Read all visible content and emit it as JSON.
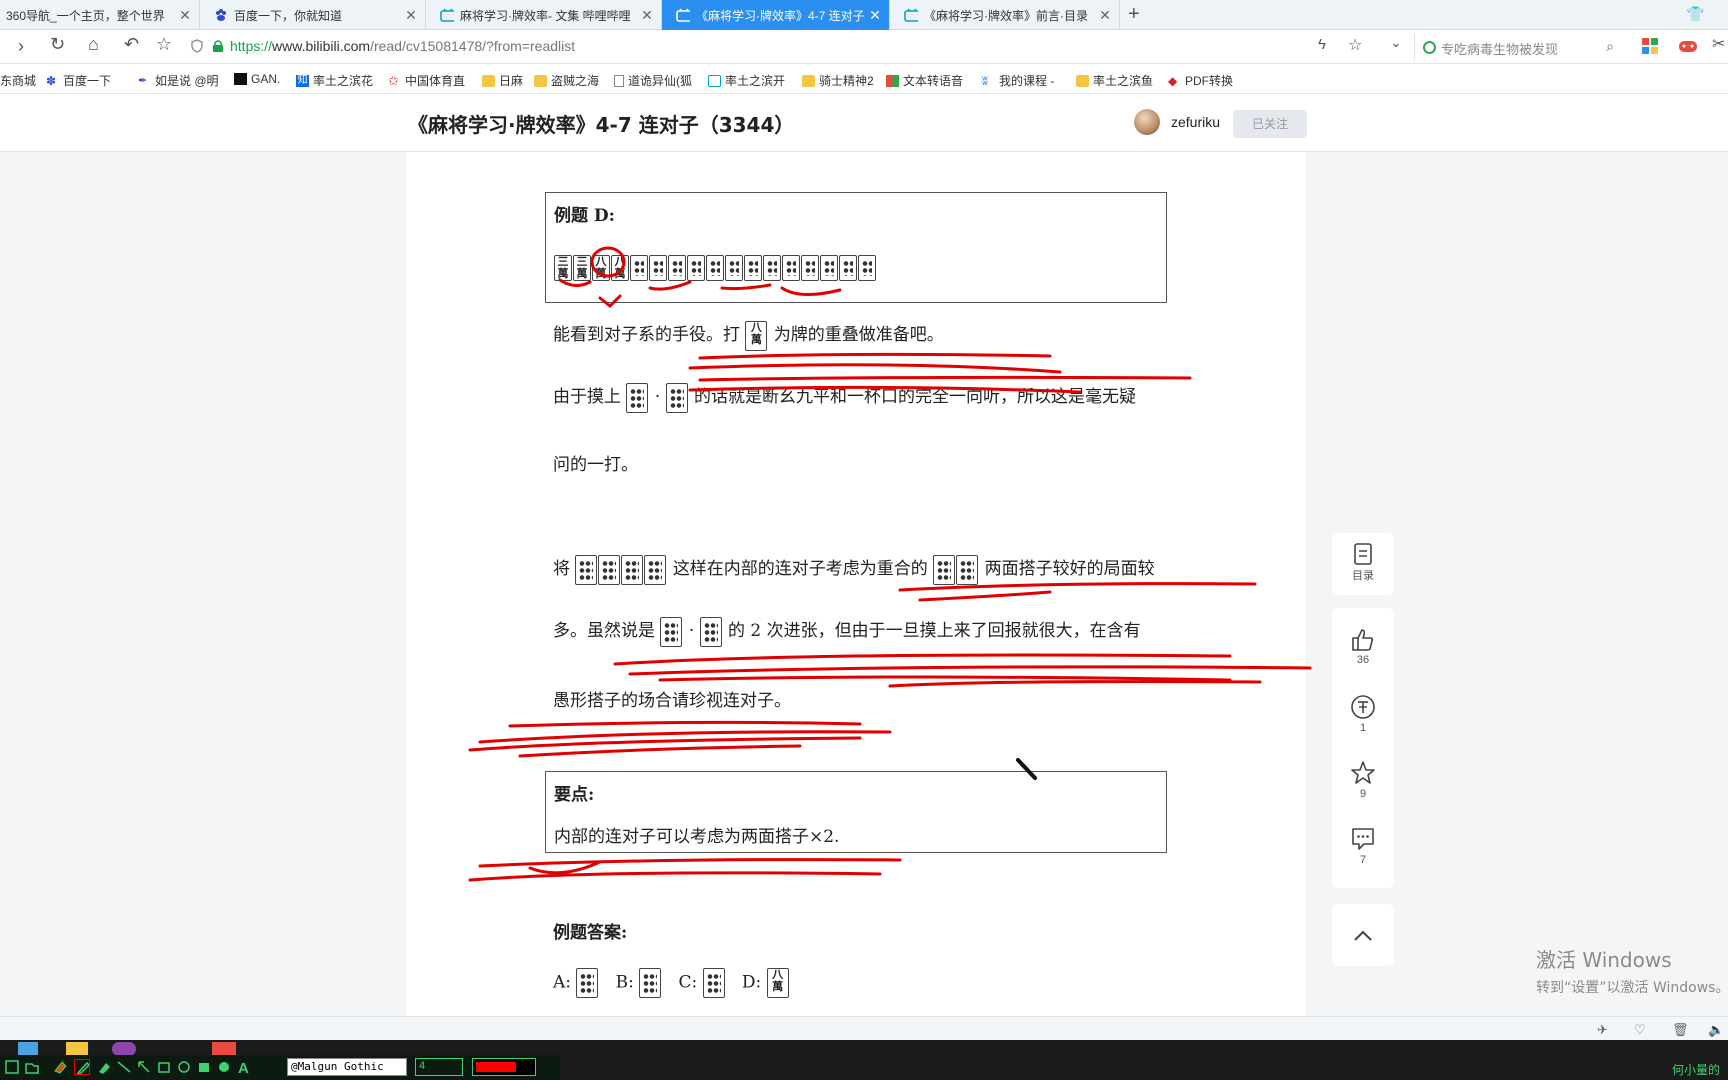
{
  "tabs": [
    {
      "label": "360导航_一个主页，整个世界",
      "active": false
    },
    {
      "label": "百度一下，你就知道",
      "active": false
    },
    {
      "label": "麻将学习·牌效率- 文集 哔哩哔哩",
      "active": false
    },
    {
      "label": "《麻将学习·牌效率》4-7 连对子",
      "active": true
    },
    {
      "label": "《麻将学习·牌效率》前言·目录",
      "active": false
    }
  ],
  "address": {
    "scheme": "https://",
    "host": "www.bilibili.com",
    "path": "/read/cv15081478/?from=readlist"
  },
  "search": {
    "placeholder": "专吃病毒生物被发现"
  },
  "bookmarks": [
    {
      "label": "东商城",
      "icon": "none"
    },
    {
      "label": "百度一下",
      "icon": "paw-icon"
    },
    {
      "label": "如是说 @明",
      "icon": "feather-icon"
    },
    {
      "label": "GAN.",
      "icon": "gan-icon"
    },
    {
      "label": "率土之滨花",
      "icon": "zhihu-icon"
    },
    {
      "label": "中国体育直",
      "icon": "star-icon"
    },
    {
      "label": "日麻",
      "icon": "folder-icon"
    },
    {
      "label": "盗贼之海",
      "icon": "folder-icon"
    },
    {
      "label": "道诡异仙(狐",
      "icon": "page-icon"
    },
    {
      "label": "率土之滨开",
      "icon": "bili-icon"
    },
    {
      "label": "骑士精神2",
      "icon": "folder-icon"
    },
    {
      "label": "文本转语音",
      "icon": "windows-icon"
    },
    {
      "label": "我的课程 -",
      "icon": "course-icon"
    },
    {
      "label": "率土之滨鱼",
      "icon": "folder-icon"
    },
    {
      "label": "PDF转换",
      "icon": "pdf-icon"
    }
  ],
  "article": {
    "title": "《麻将学习·牌效率》4-7 连对子（3344）",
    "author": "zefuriku",
    "follow_label": "已关注"
  },
  "example_box": {
    "heading": "例题 D:"
  },
  "paragraphs": {
    "p1_a": "能看到对子系的手役。打",
    "p1_b": "为牌的重叠做准备吧。",
    "p2_a": "由于摸上",
    "p2_dot": "·",
    "p2_b": "的话就是断幺九平和一杯口的完全一向听，所以这是毫无疑",
    "p2_c": "问的一打。",
    "p3_a": "将",
    "p3_b": "这样在内部的连对子考虑为重合的",
    "p3_c": "两面搭子较好的局面较",
    "p4_a": "多。虽然说是",
    "p4_dot": "·",
    "p4_b": "的 2 次进张，但由于一旦摸上来了回报就很大，在含有",
    "p5": "愚形搭子的场合请珍视连对子。"
  },
  "key_box": {
    "heading": "要点:",
    "text": "内部的连对子可以考虑为两面搭子×2."
  },
  "answer": {
    "heading": "例题答案:",
    "labels": [
      "A:",
      "B:",
      "C:",
      "D:"
    ]
  },
  "sidebar": {
    "toc_label": "目录",
    "like_count": "36",
    "coin_count": "1",
    "fav_count": "9",
    "comment_count": "7"
  },
  "watermark": {
    "line1": "激活 Windows",
    "line2": "转到“设置”以激活 Windows。"
  },
  "drawbar": {
    "font": "@Malgun Gothic",
    "size": "4",
    "color": "#ff0000"
  },
  "tray": {
    "user": "何小量的"
  },
  "colors": {
    "accent": "#2b8ef1",
    "marker": "#e00000"
  }
}
